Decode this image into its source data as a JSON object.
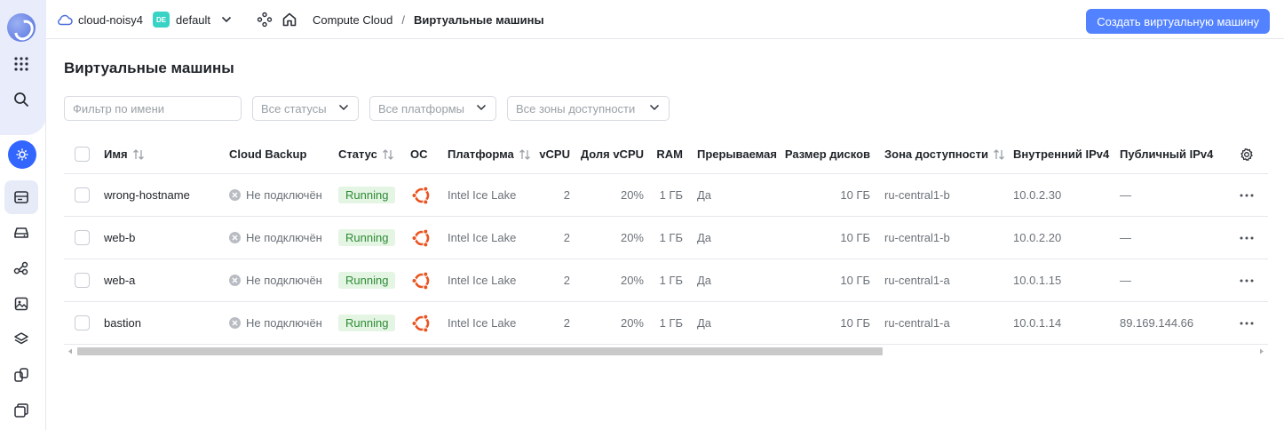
{
  "header": {
    "cloud_name": "cloud-noisy4",
    "folder_badge": "DE",
    "folder_name": "default",
    "breadcrumb_service": "Compute Cloud",
    "breadcrumb_separator": "/",
    "breadcrumb_current": "Виртуальные машины",
    "create_button": "Создать виртуальную машину"
  },
  "page": {
    "title": "Виртуальные машины"
  },
  "filters": {
    "name_placeholder": "Фильтр по имени",
    "status": "Все статусы",
    "platform": "Все платформы",
    "zone": "Все зоны доступности"
  },
  "table": {
    "columns": {
      "name": "Имя",
      "backup": "Cloud Backup",
      "status": "Статус",
      "os": "ОС",
      "platform": "Платформа",
      "vcpu": "vCPU",
      "vcpu_share": "Доля vCPU",
      "ram": "RAM",
      "preemptible": "Прерываемая",
      "disk_size": "Размер дисков",
      "zone": "Зона доступности",
      "ipv4_internal": "Внутренний IPv4",
      "ipv4_public": "Публичный IPv4"
    },
    "rows": [
      {
        "name": "wrong-hostname",
        "backup": "Не подключён",
        "status": "Running",
        "os": "ubuntu",
        "platform": "Intel Ice Lake",
        "vcpu": "2",
        "vcpu_share": "20%",
        "ram": "1 ГБ",
        "preemptible": "Да",
        "disk_size": "10 ГБ",
        "zone": "ru-central1-b",
        "ipv4_internal": "10.0.2.30",
        "ipv4_public": "—"
      },
      {
        "name": "web-b",
        "backup": "Не подключён",
        "status": "Running",
        "os": "ubuntu",
        "platform": "Intel Ice Lake",
        "vcpu": "2",
        "vcpu_share": "20%",
        "ram": "1 ГБ",
        "preemptible": "Да",
        "disk_size": "10 ГБ",
        "zone": "ru-central1-b",
        "ipv4_internal": "10.0.2.20",
        "ipv4_public": "—"
      },
      {
        "name": "web-a",
        "backup": "Не подключён",
        "status": "Running",
        "os": "ubuntu",
        "platform": "Intel Ice Lake",
        "vcpu": "2",
        "vcpu_share": "20%",
        "ram": "1 ГБ",
        "preemptible": "Да",
        "disk_size": "10 ГБ",
        "zone": "ru-central1-a",
        "ipv4_internal": "10.0.1.15",
        "ipv4_public": "—"
      },
      {
        "name": "bastion",
        "backup": "Не подключён",
        "status": "Running",
        "os": "ubuntu",
        "platform": "Intel Ice Lake",
        "vcpu": "2",
        "vcpu_share": "20%",
        "ram": "1 ГБ",
        "preemptible": "Да",
        "disk_size": "10 ГБ",
        "zone": "ru-central1-a",
        "ipv4_internal": "10.0.1.14",
        "ipv4_public": "89.169.144.66"
      }
    ]
  },
  "colors": {
    "accent": "#5282ff",
    "running_bg": "#e4f5e4",
    "running_text": "#2e8b34",
    "ubuntu": "#e95420",
    "folder_badge": "#39d3c6"
  }
}
